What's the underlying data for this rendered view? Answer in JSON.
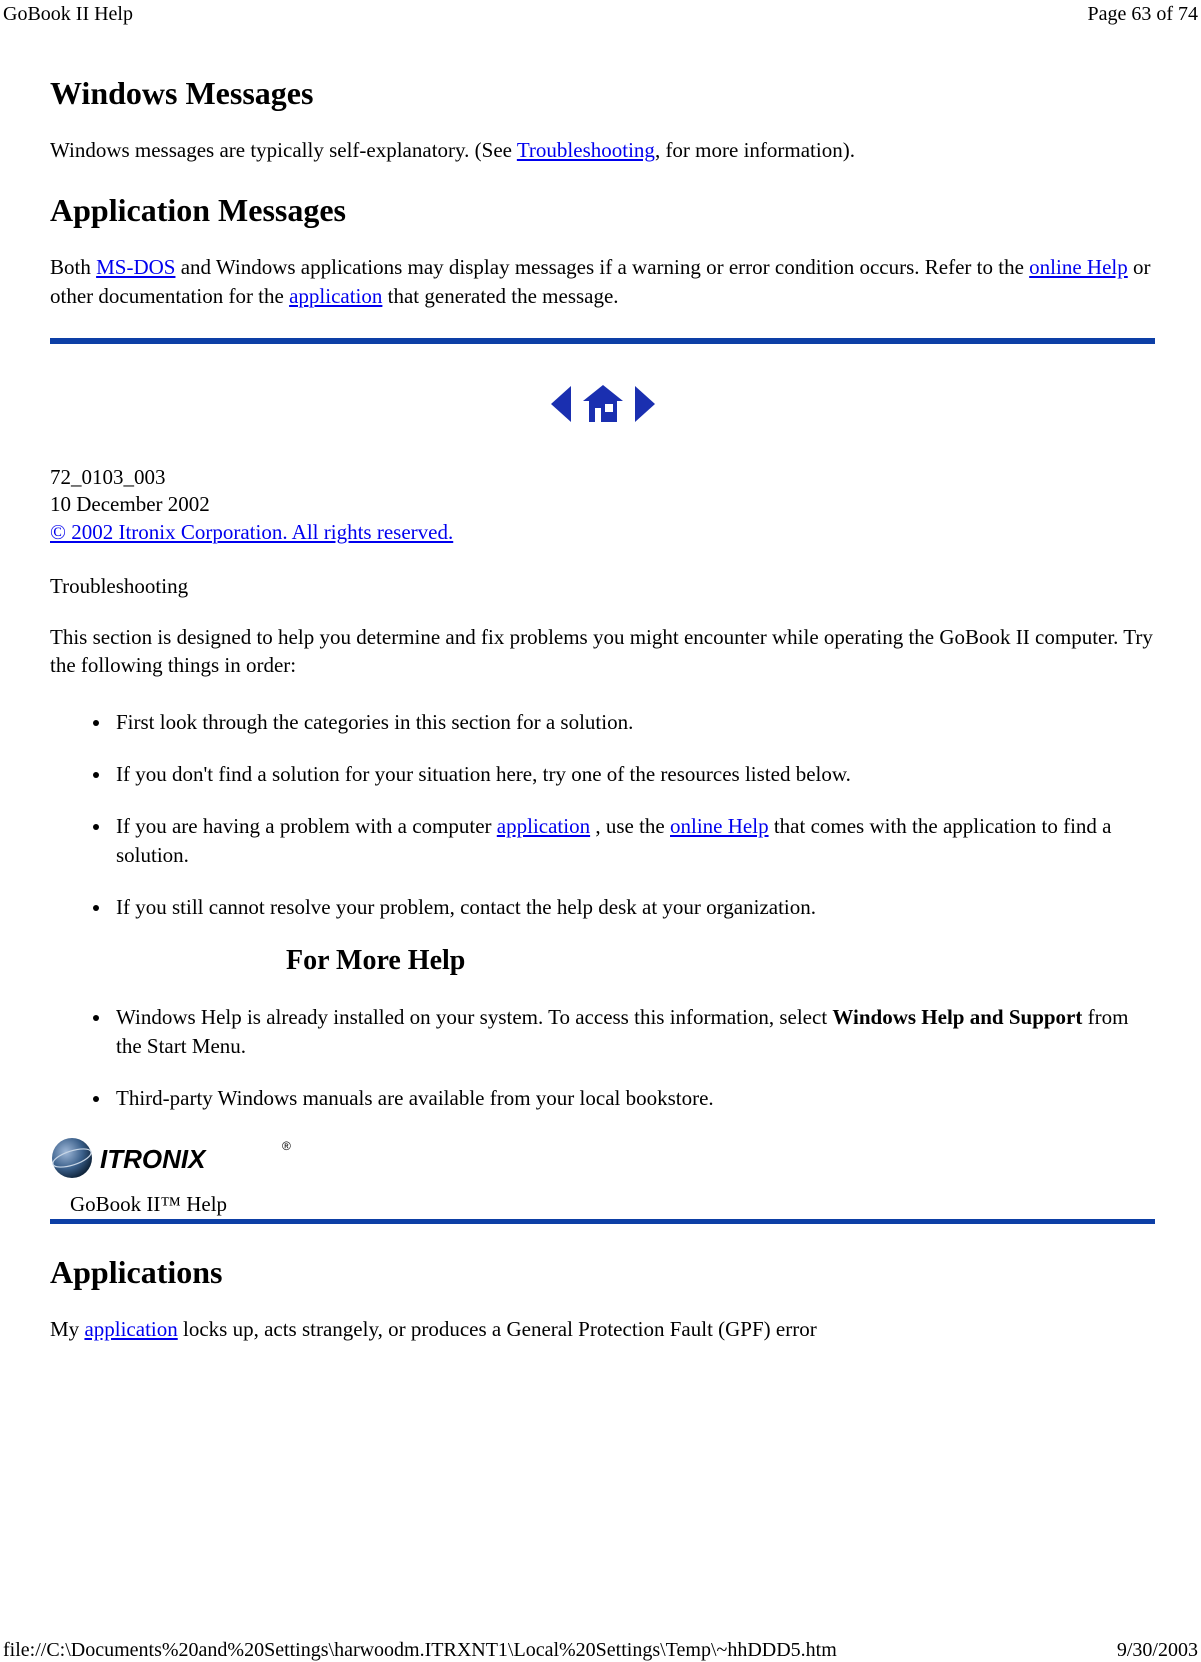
{
  "header": {
    "title": "GoBook II Help",
    "page": "Page 63 of 74"
  },
  "footer": {
    "path": "file://C:\\Documents%20and%20Settings\\harwoodm.ITRXNT1\\Local%20Settings\\Temp\\~hhDDD5.htm",
    "date": "9/30/2003"
  },
  "h_windows_messages": "Windows Messages",
  "p_windows_1a": "Windows messages are typically self-explanatory. (See ",
  "link_troubleshooting": "Troubleshooting",
  "p_windows_1b": ", for more information).",
  "h_application_messages": "Application Messages",
  "p_app_1a": "Both ",
  "link_msdos": "MS-DOS",
  "p_app_1b": " and Windows applications may display messages if a warning or error condition occurs. Refer to the ",
  "link_online_help": "online Help",
  "p_app_1c": " or other documentation for the ",
  "link_application": "application",
  "p_app_1d": " that generated the message.",
  "meta": {
    "docnum": "72_0103_003",
    "date": "10 December 2002",
    "copyright": "© 2002 Itronix Corporation.  All rights reserved."
  },
  "h_troubleshooting": "Troubleshooting",
  "p_ts_intro": "This section is designed to help you determine and fix problems you might encounter while operating the GoBook II computer. Try the following things in order:",
  "bullets1": {
    "b1": "First look through the categories in this section for a solution.",
    "b2": "If you don't find a solution for your situation here, try one of the resources listed below.",
    "b3a": "If you are having a problem with a computer ",
    "b3_link1": "application",
    "b3b": " , use the ",
    "b3_link2": "online Help",
    "b3c": " that comes with the application to find a solution.",
    "b4": "If you still cannot resolve your problem, contact the help desk at your organization."
  },
  "h_for_more_help": "For More Help",
  "bullets2": {
    "b1a": "Windows Help is already installed on your system.  To access this information, select ",
    "b1_bold": "Windows Help and Support",
    "b1b": " from the Start Menu.",
    "b2": "Third-party Windows manuals are available from your local bookstore."
  },
  "logo_text": "ITRONIX",
  "logo_reg": "®",
  "help_caption": "GoBook II™ Help",
  "h_applications": "Applications",
  "p_apps_1a": "My ",
  "p_apps_link": "application",
  "p_apps_1b": " locks up, acts strangely, or produces a General Protection Fault (GPF) error"
}
